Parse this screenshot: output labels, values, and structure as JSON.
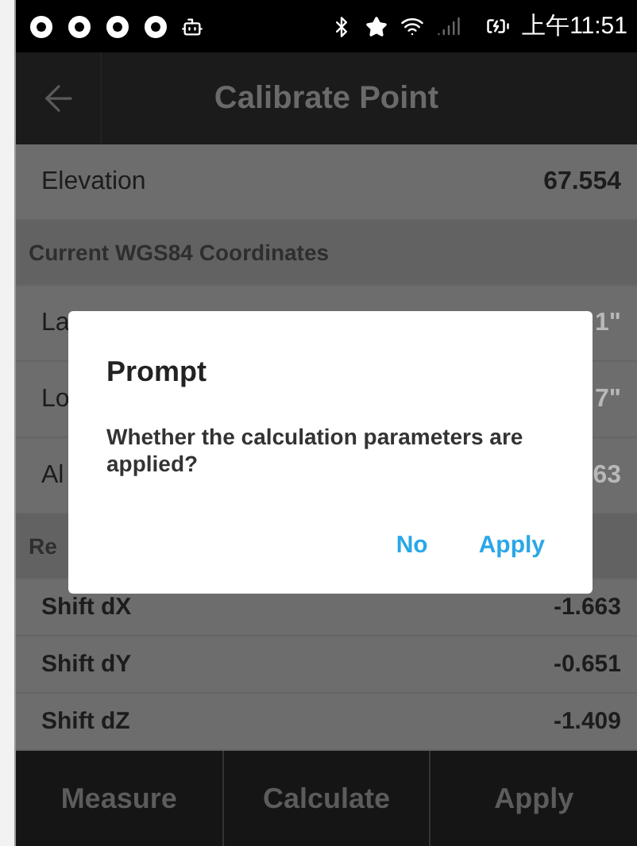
{
  "status_bar": {
    "time": "上午11:51"
  },
  "app_bar": {
    "title": "Calibrate Point"
  },
  "rows": [
    {
      "kind": "field",
      "label": "Elevation",
      "value": "67.554"
    },
    {
      "kind": "header",
      "label": "Current WGS84 Coordinates"
    },
    {
      "kind": "field",
      "label": "La",
      "value": "1\""
    },
    {
      "kind": "field",
      "label": "Lo",
      "value": "7\""
    },
    {
      "kind": "field",
      "label": "Al",
      "value": "63"
    },
    {
      "kind": "header",
      "label": "Re"
    },
    {
      "kind": "compact",
      "label": "Shift dX",
      "value": "-1.663"
    },
    {
      "kind": "compact",
      "label": "Shift dY",
      "value": "-0.651"
    },
    {
      "kind": "compact",
      "label": "Shift dZ",
      "value": "-1.409"
    }
  ],
  "dialog": {
    "title": "Prompt",
    "message": "Whether the calculation parameters are applied?",
    "buttons": [
      "No",
      "Apply"
    ]
  },
  "bottom_bar": {
    "buttons": [
      "Measure",
      "Calculate",
      "Apply"
    ]
  }
}
